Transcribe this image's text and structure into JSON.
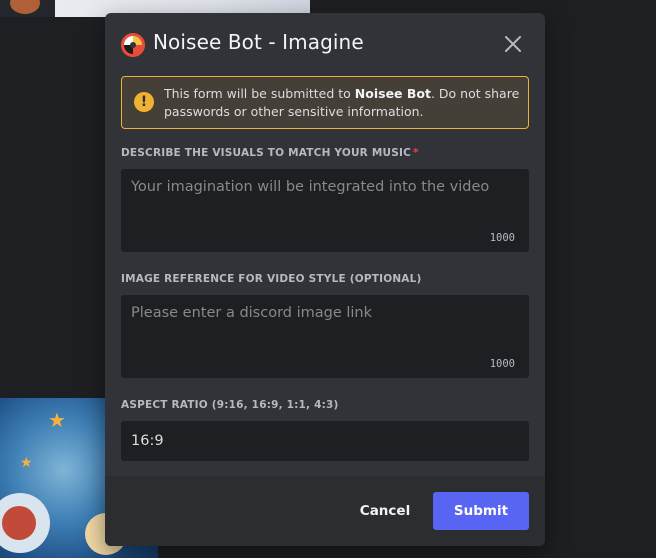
{
  "modal": {
    "app_icon": "noisee-bot-icon",
    "title": "Noisee Bot - Imagine",
    "close_icon": "close-icon"
  },
  "notice": {
    "icon": "warning-icon",
    "prefix": "This form will be submitted to ",
    "bot_name": "Noisee Bot",
    "suffix": ". Do not share passwords or other sensitive information.",
    "color": "#f0b232"
  },
  "fields": {
    "visuals": {
      "label": "Describe the visuals to match your music",
      "required_mark": "*",
      "placeholder": "Your imagination will be integrated into the video",
      "value": "",
      "max_length": "1000"
    },
    "image_reference": {
      "label": "Image reference for video style (optional)",
      "placeholder": "Please enter a discord image link",
      "value": "",
      "max_length": "1000"
    },
    "aspect_ratio": {
      "label": "Aspect ratio (9:16, 16:9, 1:1, 4:3)",
      "value": "16:9"
    }
  },
  "footer": {
    "cancel_label": "Cancel",
    "submit_label": "Submit",
    "submit_color": "#5865f2"
  }
}
